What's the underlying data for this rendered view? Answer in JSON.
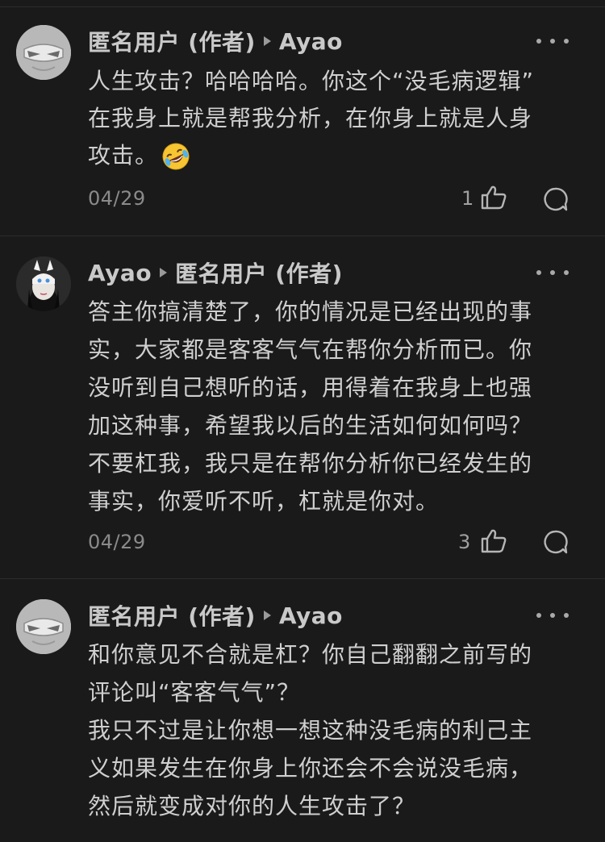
{
  "comments": [
    {
      "author": "匿名用户 (作者)",
      "reply_to": "Ayao",
      "lines": [
        "人生攻击？哈哈哈哈。你这个“没毛病逻辑”",
        "在我身上就是帮我分析，在你身上就是人身",
        "攻击。"
      ],
      "emoji": "rolling-on-floor-laughing-emoji",
      "date": "04/29",
      "likes": "1"
    },
    {
      "author": "Ayao",
      "reply_to": "匿名用户 (作者)",
      "lines": [
        "答主你搞清楚了，你的情况是已经出现的事",
        "实，大家都是客客气气在帮你分析而已。你",
        "没听到自己想听的话，用得着在我身上也强",
        "加这种事，希望我以后的生活如何如何吗？",
        "不要杠我，我只是在帮你分析你已经发生的",
        "事实，你爱听不听，杠就是你对。"
      ],
      "date": "04/29",
      "likes": "3"
    },
    {
      "author": "匿名用户 (作者)",
      "reply_to": "Ayao",
      "lines": [
        "和你意见不合就是杠？你自己翻翻之前写的",
        "评论叫“客客气气”？",
        "我只不过是让你想一想这种没毛病的利己主",
        "义如果发生在你身上你还会不会说没毛病，",
        "然后就变成对你的人生攻击了？"
      ]
    }
  ],
  "icons": {
    "more": "more-dots-icon",
    "like": "thumbs-up-icon",
    "reply": "comment-bubble-icon",
    "reply_arrow": "play-arrow-icon"
  },
  "colors": {
    "background": "#1a1a1a",
    "text": "#cfcfcf",
    "muted": "#8a8a8a",
    "divider": "#2c2c2c"
  }
}
